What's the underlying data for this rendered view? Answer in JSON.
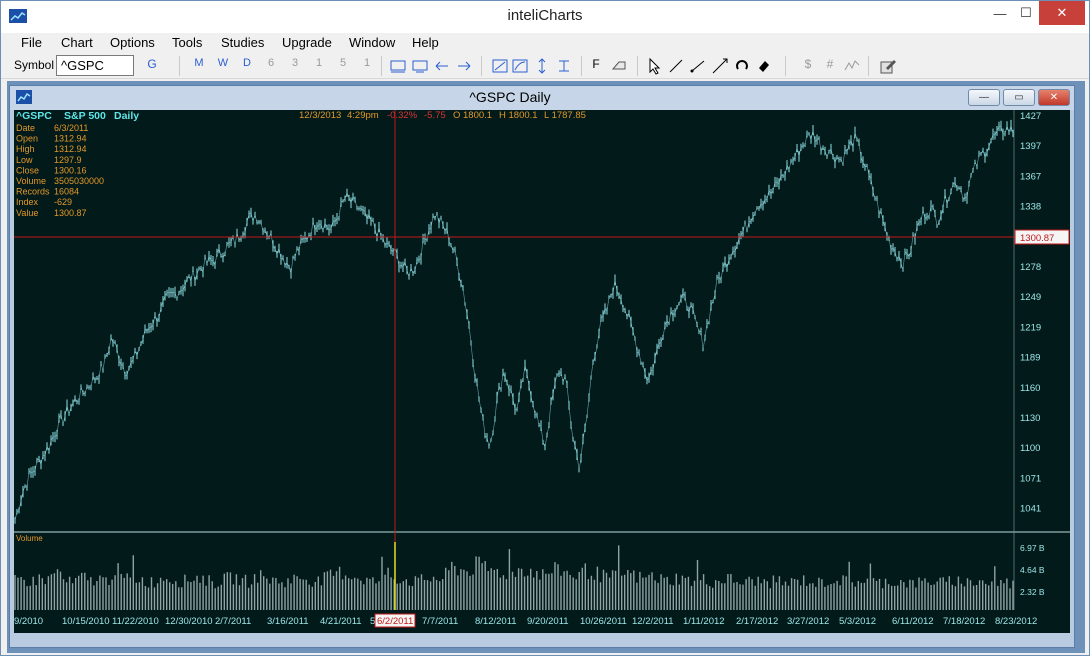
{
  "app": {
    "title": "inteliCharts"
  },
  "window_controls": {
    "minimize": "—",
    "maximize": "☐",
    "close": "✕"
  },
  "menu": [
    "File",
    "Chart",
    "Options",
    "Tools",
    "Studies",
    "Upgrade",
    "Window",
    "Help"
  ],
  "toolbar": {
    "symbol_label": "Symbol",
    "symbol_value": "^GSPC",
    "go_label": "G",
    "periods": [
      "M",
      "W",
      "D",
      "6",
      "3",
      "1",
      "5",
      "1"
    ],
    "draw_label": "F",
    "right_labels": [
      "$",
      "#"
    ]
  },
  "child_window": {
    "title": "^GSPC Daily",
    "minimize": "—",
    "maximize": "▭",
    "close": "✕"
  },
  "colors": {
    "background": "#031a1a",
    "price_line": "#8fe0e6",
    "crosshair": "#c01818",
    "header_cyan": "#5ee6e8",
    "info_orange": "#e39828",
    "change_red": "#e03232",
    "axis_text": "#9ce6e8",
    "volume_bar": "#8fa3a3"
  },
  "header": {
    "symbol": "^GSPC",
    "name": "S&P 500",
    "period": "Daily",
    "date": "12/3/2013",
    "time": "4:29pm",
    "change_pct": "-0.32%",
    "change": "-5.75",
    "ohlc": [
      "O 1800.1",
      "H 1800.1",
      "L 1787.85"
    ]
  },
  "info_panel": [
    {
      "label": "Date",
      "value": "6/3/2011"
    },
    {
      "label": "Open",
      "value": "1312.94"
    },
    {
      "label": "High",
      "value": "1312.94"
    },
    {
      "label": "Low",
      "value": "1297.9"
    },
    {
      "label": "Close",
      "value": "1300.16"
    },
    {
      "label": "Volume",
      "value": "3505030000"
    },
    {
      "label": "Records",
      "value": "16084"
    },
    {
      "label": "Index",
      "value": "-629"
    },
    {
      "label": "Value",
      "value": "1300.87"
    }
  ],
  "volume_panel_label": "Volume",
  "cursor_date": "6/2/2011",
  "cursor_value_label": "1300.87",
  "chart_data": {
    "type": "line",
    "price_ticks": [
      1427,
      1397,
      1367,
      1338,
      1308,
      1278,
      1249,
      1219,
      1189,
      1160,
      1130,
      1100,
      1071,
      1041
    ],
    "volume_ticks": [
      "6.97 B",
      "4.64 B",
      "2.32 B"
    ],
    "x_tick_labels": [
      "9/2010",
      "10/15/2010",
      "11/22/2010",
      "12/30/2010",
      "2/7/2011",
      "3/16/2011",
      "4/21/2011",
      "5/",
      "7/7/2011",
      "8/12/2011",
      "9/20/2011",
      "10/26/2011",
      "12/2/2011",
      "1/11/2012",
      "2/17/2012",
      "3/27/2012",
      "5/3/2012",
      "6/11/2012",
      "7/18/2012",
      "8/23/2012"
    ],
    "price_series": [
      1050,
      1075,
      1090,
      1100,
      1110,
      1120,
      1135,
      1145,
      1155,
      1163,
      1170,
      1178,
      1185,
      1195,
      1220,
      1205,
      1190,
      1195,
      1210,
      1225,
      1235,
      1242,
      1255,
      1260,
      1265,
      1272,
      1278,
      1285,
      1290,
      1292,
      1300,
      1305,
      1310,
      1320,
      1330,
      1335,
      1325,
      1315,
      1305,
      1295,
      1285,
      1300,
      1310,
      1320,
      1330,
      1325,
      1320,
      1335,
      1350,
      1345,
      1340,
      1330,
      1325,
      1315,
      1305,
      1300,
      1290,
      1280,
      1285,
      1300,
      1320,
      1335,
      1325,
      1315,
      1295,
      1270,
      1230,
      1180,
      1140,
      1120,
      1160,
      1190,
      1170,
      1150,
      1190,
      1170,
      1140,
      1120,
      1160,
      1190,
      1180,
      1130,
      1100,
      1140,
      1200,
      1230,
      1245,
      1270,
      1260,
      1240,
      1220,
      1200,
      1180,
      1200,
      1225,
      1240,
      1250,
      1255,
      1250,
      1230,
      1215,
      1245,
      1270,
      1285,
      1300,
      1310,
      1320,
      1335,
      1345,
      1350,
      1355,
      1365,
      1375,
      1385,
      1395,
      1405,
      1410,
      1400,
      1395,
      1390,
      1385,
      1395,
      1405,
      1390,
      1370,
      1350,
      1330,
      1310,
      1300,
      1290,
      1300,
      1320,
      1335,
      1340,
      1330,
      1345,
      1360,
      1365,
      1350,
      1370,
      1385,
      1395,
      1405,
      1410,
      1415,
      1412
    ],
    "price_high": 1427,
    "price_low": 1041,
    "volume_series_in_billions": [
      4.1,
      4.3,
      3.9,
      4.5,
      4.2,
      5.5,
      4.0,
      3.8,
      4.6,
      4.1,
      4.4,
      4.0,
      5.8,
      4.2,
      4.5,
      4.3,
      3.9,
      4.1,
      4.7,
      4.2,
      4.0,
      4.4,
      4.6,
      4.1,
      3.8,
      4.3,
      4.5,
      4.2,
      4.0,
      4.8,
      4.4,
      4.1,
      3.9,
      4.2,
      4.6,
      4.3,
      4.0,
      4.4,
      4.9,
      5.2,
      4.8,
      4.5,
      4.2,
      4.0,
      4.3,
      4.6,
      4.4,
      4.1,
      4.0,
      4.3,
      4.5,
      4.2,
      5.9,
      5.6,
      5.3,
      6.1,
      5.8,
      5.4,
      5.2,
      5.0,
      5.5,
      5.7,
      5.1,
      4.9,
      5.3,
      5.6,
      5.0,
      4.8,
      5.4,
      5.2,
      4.7,
      4.5,
      4.9,
      5.1,
      4.6,
      4.4,
      4.7,
      4.3,
      4.1,
      4.5,
      4.2,
      4.0,
      4.3,
      3.9,
      4.1,
      4.4,
      4.0,
      3.8,
      4.2,
      4.0,
      3.9,
      4.1,
      3.7,
      4.0,
      4.2,
      3.9,
      3.8,
      4.1,
      4.3,
      4.0,
      3.9,
      4.2,
      4.0,
      3.8,
      4.1,
      3.9,
      4.0,
      3.7,
      3.9,
      4.1,
      4.0,
      3.8,
      4.2,
      4.0,
      3.9,
      4.1,
      3.8,
      3.7,
      4.0,
      3.6
    ]
  }
}
